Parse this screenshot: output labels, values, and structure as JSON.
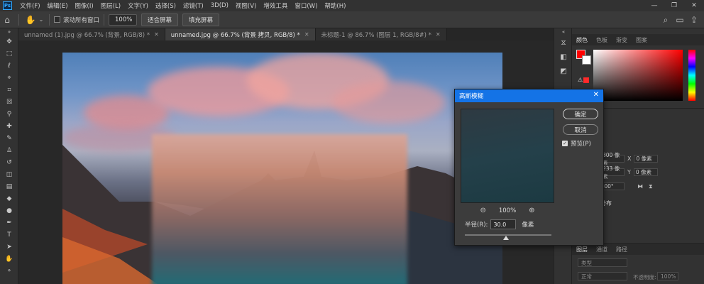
{
  "menu": {
    "logo": "Ps",
    "items": [
      "文件(F)",
      "编辑(E)",
      "图像(I)",
      "图层(L)",
      "文字(Y)",
      "选择(S)",
      "滤镜(T)",
      "3D(D)",
      "视图(V)",
      "增效工具",
      "窗口(W)",
      "帮助(H)"
    ]
  },
  "options": {
    "scroll_all_label": "滚动所有窗口",
    "zoom_value": "100%",
    "fit_screen_label": "适合屏幕",
    "fill_screen_label": "填充屏幕"
  },
  "tabs": [
    {
      "label": "unnamed (1).jpg @ 66.7% (背景, RGB/8) *",
      "active": false
    },
    {
      "label": "unnamed.jpg @ 66.7% (背景 拷贝, RGB/8) *",
      "active": true
    },
    {
      "label": "未标题-1 @ 86.7% (图层 1, RGB/8#) *",
      "active": false
    }
  ],
  "color_panel": {
    "tabs": [
      "颜色",
      "色板",
      "渐变",
      "图案"
    ],
    "foreground": "#ff0000",
    "background": "#ffffff"
  },
  "properties": {
    "w_value": "800 像素",
    "h_value": "233 像素",
    "x_label": "X",
    "x_value": "0 像素",
    "y_label": "Y",
    "y_value": "0 像素",
    "angle_value": ".00°",
    "distribute_label": "分布"
  },
  "layers_panel": {
    "tabs": [
      "图层",
      "通道",
      "路径"
    ],
    "search_placeholder": "类型",
    "blend_mode": "正常",
    "opacity_label": "不透明度:",
    "opacity_value": "100%"
  },
  "dialog": {
    "title": "高斯模糊",
    "ok_label": "确定",
    "cancel_label": "取消",
    "preview_label": "预览(P)",
    "zoom": "100%",
    "radius_label": "半径(R):",
    "radius_value": "30.0",
    "radius_unit": "像素"
  }
}
